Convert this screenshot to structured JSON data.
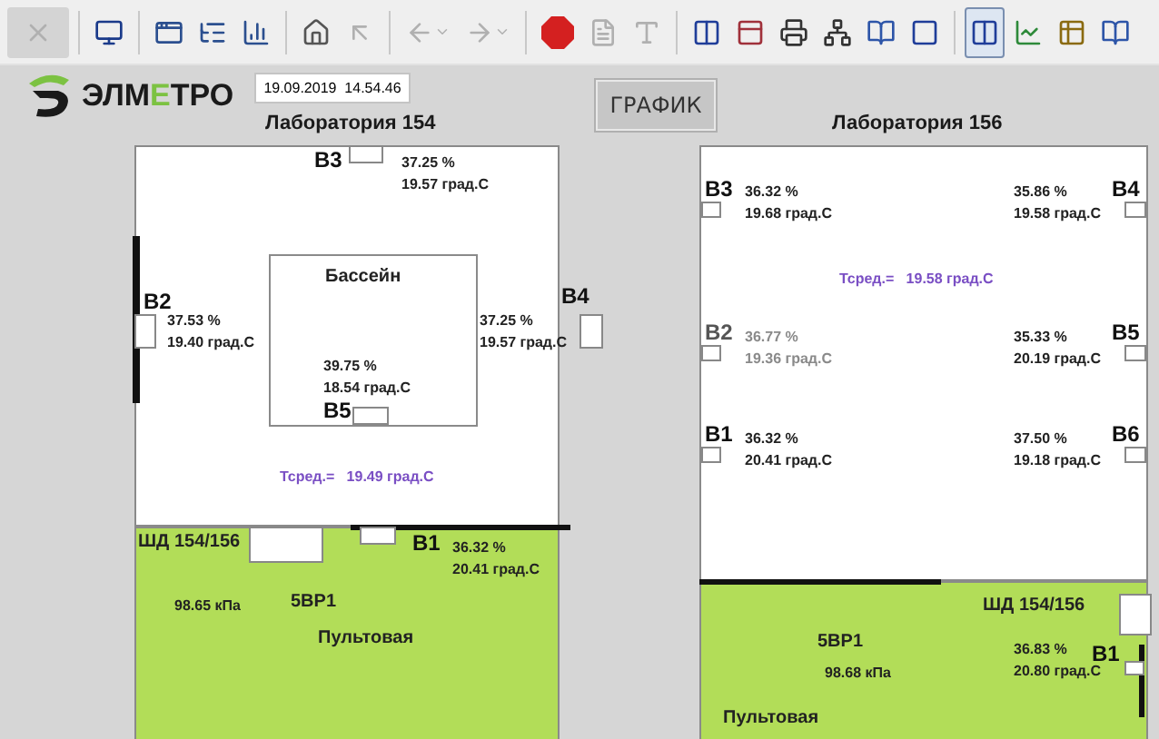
{
  "toolbar": [
    {
      "items": [
        {
          "kind": "close",
          "disabled": true,
          "selected": false
        }
      ]
    },
    {
      "items": [
        {
          "kind": "monitor",
          "disabled": false,
          "selected": false
        }
      ]
    },
    {
      "items": [
        {
          "kind": "window",
          "disabled": false,
          "selected": false
        },
        {
          "kind": "list",
          "disabled": false,
          "selected": false
        },
        {
          "kind": "bars",
          "disabled": false,
          "selected": false
        }
      ]
    },
    {
      "items": [
        {
          "kind": "home",
          "disabled": false,
          "selected": false
        },
        {
          "kind": "up",
          "disabled": true,
          "selected": false
        }
      ]
    },
    {
      "items": [
        {
          "kind": "back",
          "disabled": true,
          "selected": false
        },
        {
          "kind": "forward",
          "disabled": true,
          "selected": false
        }
      ]
    },
    {
      "items": [
        {
          "kind": "stop",
          "disabled": false,
          "selected": false
        },
        {
          "kind": "document",
          "disabled": true,
          "selected": false
        },
        {
          "kind": "font",
          "disabled": true,
          "selected": false
        }
      ]
    },
    {
      "items": [
        {
          "kind": "columns",
          "disabled": false,
          "selected": false
        },
        {
          "kind": "panel",
          "disabled": false,
          "selected": false
        },
        {
          "kind": "printer",
          "disabled": false,
          "selected": false
        },
        {
          "kind": "network",
          "disabled": false,
          "selected": false
        },
        {
          "kind": "book",
          "disabled": false,
          "selected": false
        },
        {
          "kind": "frame",
          "disabled": false,
          "selected": false
        }
      ]
    },
    {
      "items": [
        {
          "kind": "columns",
          "disabled": false,
          "selected": true
        },
        {
          "kind": "chart",
          "disabled": false,
          "selected": false
        },
        {
          "kind": "table",
          "disabled": false,
          "selected": false
        },
        {
          "kind": "book",
          "disabled": false,
          "selected": false
        }
      ]
    }
  ],
  "logo": {
    "parts": [
      {
        "text": "ЭЛМ",
        "accent": false
      },
      {
        "text": "Е",
        "accent": true
      },
      {
        "text": "ТРО",
        "accent": false
      }
    ]
  },
  "datetime": "19.09.2019  14.54.46",
  "graph_button": "ГРАФИК",
  "labs": [
    {
      "title": "Лаборатория 154",
      "pool": "Бассейн",
      "average": "Тсред.=   19.49 град.С",
      "sensors": [
        {
          "label": "В3",
          "humidity": "37.25 %",
          "temperature": "19.57 град.С",
          "stale": false
        },
        {
          "label": "В2",
          "humidity": "37.53 %",
          "temperature": "19.40 град.С",
          "stale": false
        },
        {
          "label": "В4",
          "humidity": "37.25 %",
          "temperature": "19.57 град.С",
          "stale": false
        },
        {
          "label": "В5",
          "humidity": "39.75 %",
          "temperature": "18.54 град.С",
          "stale": false
        },
        {
          "label": "В1",
          "humidity": "36.32 %",
          "temperature": "20.41 град.С",
          "stale": false
        }
      ],
      "cabinet": "ШД 154/156",
      "device": "5ВР1",
      "pressure": "98.65 кПа",
      "room": "Пультовая"
    },
    {
      "title": "Лаборатория 156",
      "average": "Тсред.=   19.58 град.С",
      "sensors": [
        {
          "label": "В3",
          "humidity": "36.32 %",
          "temperature": "19.68 град.С",
          "stale": false
        },
        {
          "label": "В4",
          "humidity": "35.86 %",
          "temperature": "19.58 град.С",
          "stale": false
        },
        {
          "label": "В2",
          "humidity": "36.77 %",
          "temperature": "19.36 град.С",
          "stale": true
        },
        {
          "label": "В5",
          "humidity": "35.33 %",
          "temperature": "20.19 град.С",
          "stale": false
        },
        {
          "label": "В1",
          "humidity": "36.32 %",
          "temperature": "20.41 град.С",
          "stale": false
        },
        {
          "label": "В6",
          "humidity": "37.50 %",
          "temperature": "19.18 град.С",
          "stale": false
        },
        {
          "label": "В1",
          "humidity": "36.83 %",
          "temperature": "20.80 град.С",
          "stale": false
        }
      ],
      "cabinet": "ШД 154/156",
      "device": "5ВР1",
      "pressure": "98.68 кПа",
      "room": "Пультовая"
    }
  ]
}
